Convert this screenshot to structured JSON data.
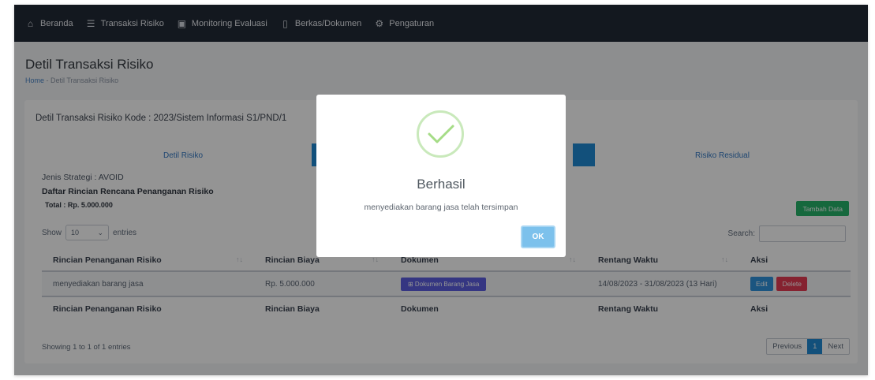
{
  "nav": {
    "items": [
      {
        "label": "Beranda",
        "icon": "home-icon"
      },
      {
        "label": "Transaksi Risiko",
        "icon": "list-icon"
      },
      {
        "label": "Monitoring Evaluasi",
        "icon": "monitor-icon"
      },
      {
        "label": "Berkas/Dokumen",
        "icon": "file-icon"
      },
      {
        "label": "Pengaturan",
        "icon": "gear-icon"
      }
    ]
  },
  "page": {
    "title": "Detil Transaksi Risiko",
    "breadcrumb_home": "Home",
    "breadcrumb_sep": "-",
    "breadcrumb_current": "Detil Transaksi Risiko"
  },
  "card": {
    "title": "Detil Transaksi Risiko Kode : 2023/Sistem Informasi S1/PND/1",
    "tabs": [
      "Detil Risiko",
      "Risiko Residual"
    ],
    "jenis_strategi": "Jenis Strategi : AVOID",
    "daftar_title": "Daftar Rincian Rencana Penanganan Risiko",
    "total": "Total : Rp. 5.000.000",
    "tambah_label": "Tambah Data"
  },
  "table_controls": {
    "show_label": "Show",
    "show_value": "10",
    "entries_label": "entries",
    "search_label": "Search:",
    "showing": "Showing 1 to 1 of 1 entries",
    "prev": "Previous",
    "page": "1",
    "next": "Next"
  },
  "table": {
    "headers": [
      "Rincian Penanganan Risiko",
      "Rincian Biaya",
      "Dokumen",
      "Rentang Waktu",
      "Aksi"
    ],
    "rows": [
      {
        "rincian": "menyediakan barang jasa",
        "biaya": "Rp. 5.000.000",
        "dokumen": "⊞ Dokumen Barang Jasa",
        "rentang": "14/08/2023 - 31/08/2023 (13 Hari)",
        "edit": "Edit",
        "delete": "Delete"
      }
    ]
  },
  "modal": {
    "title": "Berhasil",
    "message": "menyediakan barang jasa telah tersimpan",
    "ok": "OK"
  },
  "colors": {
    "nav_bg": "#222a36",
    "primary": "#1f8ad4",
    "success": "#27b36a",
    "danger": "#e63b54",
    "doc_button": "#5c5ee0"
  }
}
